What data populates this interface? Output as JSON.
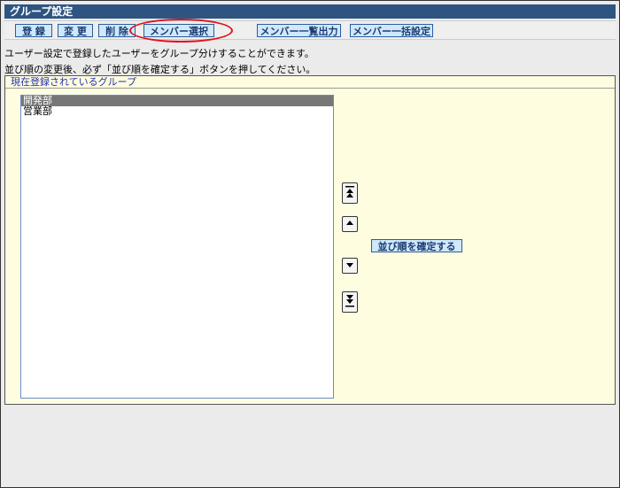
{
  "window": {
    "title": "グループ設定"
  },
  "toolbar": {
    "register": "登 録",
    "change": "変 更",
    "delete": "削 除",
    "member_select": "メンバー選択",
    "member_list_output": "メンバー一覧出力",
    "member_bulk_setting": "メンバー一括設定"
  },
  "info": {
    "line1": "ユーザー設定で登録したユーザーをグループ分けすることができます。",
    "line2": "並び順の変更後、必ず「並び順を確定する」ボタンを押してください。"
  },
  "panel": {
    "header": "現在登録されているグループ",
    "groups": [
      "開発部",
      "営業部"
    ],
    "selected_group": "開発部",
    "confirm_order": "並び順を確定する"
  },
  "icons": {
    "move_top": "move-top-icon",
    "move_up": "move-up-icon",
    "move_down": "move-down-icon",
    "move_bottom": "move-bottom-icon"
  },
  "colors": {
    "title_bar": "#2e5582",
    "button_bg": "#cfe8fb",
    "panel_bg": "#fffde0",
    "highlight": "#e0121a"
  }
}
